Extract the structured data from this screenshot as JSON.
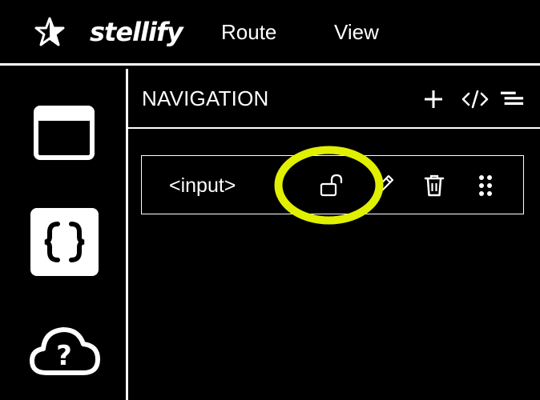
{
  "app": {
    "brand": "stellify",
    "logo_icon": "star-icon"
  },
  "menu": {
    "route_label": "Route",
    "view_label": "View"
  },
  "sidebar": {
    "items": [
      {
        "name": "window",
        "icon": "window-icon"
      },
      {
        "name": "code",
        "icon": "curly-braces-icon"
      },
      {
        "name": "help",
        "icon": "cloud-question-icon"
      }
    ]
  },
  "panel": {
    "title": "NAVIGATION",
    "actions": [
      "plus-icon",
      "code-icon",
      "tree-icon"
    ]
  },
  "rows": [
    {
      "label": "<input>",
      "icons": [
        "unlock-icon",
        "edit-icon",
        "trash-icon",
        "drag-handle-icon"
      ]
    }
  ],
  "colors": {
    "background": "#000000",
    "foreground": "#ffffff",
    "highlight": "#e0f000"
  }
}
